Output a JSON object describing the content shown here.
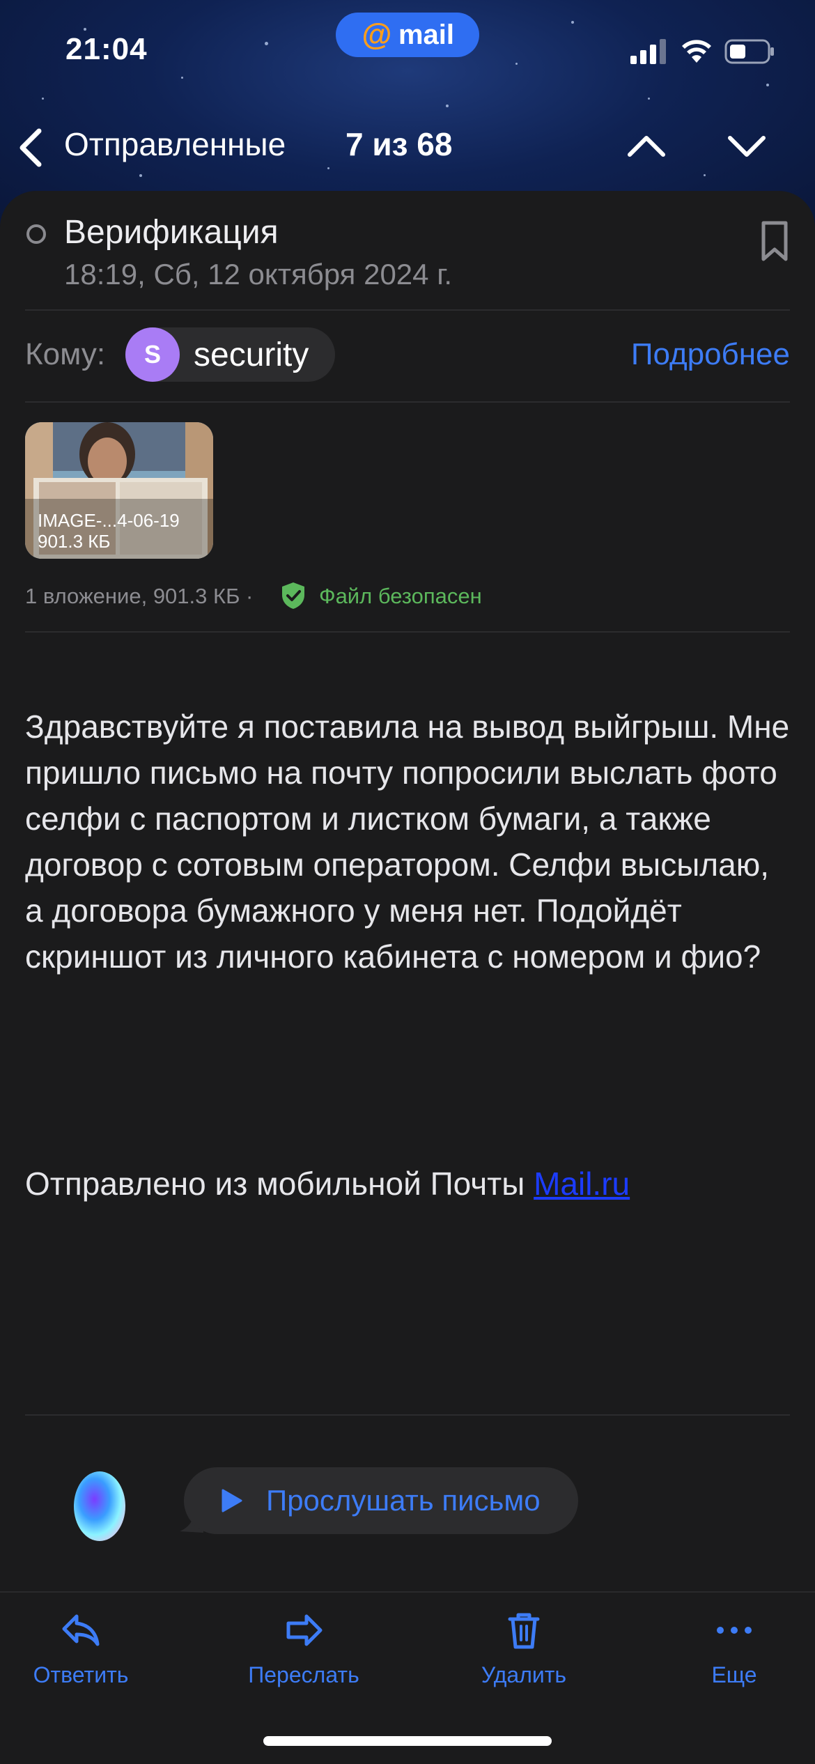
{
  "status_bar": {
    "time": "21:04",
    "app_badge": "mail",
    "app_badge_symbol": "@"
  },
  "nav": {
    "back_label": "Отправленные",
    "counter": "7 из 68"
  },
  "message": {
    "subject": "Верификация",
    "date": "18:19, Сб, 12 октября 2024 г.",
    "to_label": "Кому:",
    "recipient_initial": "S",
    "recipient_name": "security",
    "details_link": "Подробнее",
    "attachment": {
      "name": "IMAGE-...4-06-19",
      "size": "901.3 КБ",
      "summary": "1 вложение, 901.3 КБ ·",
      "safety": "Файл безопасен"
    },
    "body": "Здравствуйте я поставила на вывод выйгрыш. Мне пришло письмо на почту попросили выслать фото селфи с паспортом и листком бумаги, а также договор с сотовым оператором. Селфи высылаю, а договора бумажного у меня нет. Подойдёт скриншот из личного кабинета с номером и фио?",
    "signature_prefix": "Отправлено из мобильной Почты",
    "signature_link": "Mail.ru"
  },
  "assistant": {
    "listen_label": "Прослушать письмо"
  },
  "toolbar": {
    "reply": "Ответить",
    "forward": "Переслать",
    "delete": "Удалить",
    "more": "Еще"
  },
  "colors": {
    "accent": "#3d7cf6",
    "background": "#1b1b1c",
    "safe_green": "#5cb85c",
    "avatar_purple": "#a97cf5",
    "badge_blue": "#2f6ef2",
    "badge_at": "#ff9e1b"
  },
  "icons": [
    "back-chevron-icon",
    "chevron-up-icon",
    "chevron-down-icon",
    "bookmark-icon",
    "shield-check-icon",
    "play-icon",
    "reply-icon",
    "forward-icon",
    "trash-icon",
    "more-icon",
    "signal-icon",
    "wifi-icon",
    "battery-icon"
  ]
}
